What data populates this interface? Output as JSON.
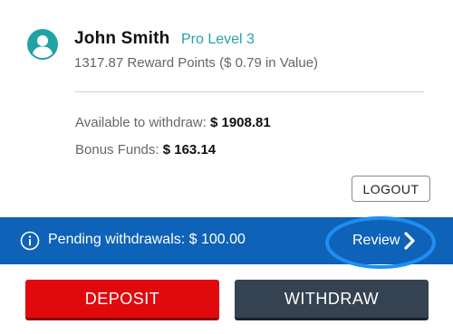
{
  "user": {
    "name": "John Smith",
    "level": "Pro Level 3",
    "reward_points": "1317.87 Reward Points ($ 0.79 in Value)"
  },
  "balances": {
    "available_label": "Available to withdraw:",
    "available_value": "$ 1908.81",
    "bonus_label": "Bonus Funds:",
    "bonus_value": "$ 163.14"
  },
  "actions": {
    "logout_label": "LOGOUT",
    "deposit_label": "DEPOSIT",
    "withdraw_label": "WITHDRAW"
  },
  "pending": {
    "text": "Pending withdrawals: $ 100.00",
    "review_label": "Review"
  },
  "icons": {
    "avatar": "user-avatar-icon",
    "info": "info-icon",
    "chevron": "chevron-right-icon"
  },
  "colors": {
    "accent_teal": "#21a3a6",
    "pending_bar": "#0e62b8",
    "highlight_ring": "#1e8ff0",
    "deposit": "#e0090c",
    "withdraw": "#354251"
  }
}
